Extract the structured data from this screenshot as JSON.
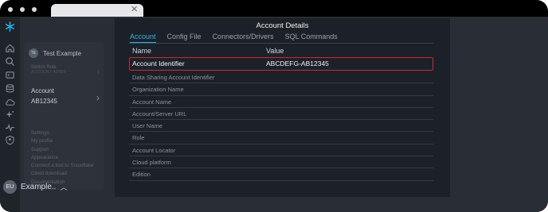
{
  "workspace": {
    "initials": "TE",
    "name": "Test Example"
  },
  "menu": {
    "switch_role_label": "Switch Role",
    "switch_role_value": "ACCOUNT ADMIN",
    "account_label": "Account",
    "account_value": "AB12345",
    "links": [
      "Settings",
      "My profile",
      "Support",
      "Appearance",
      "Connect a tool to Snowflake",
      "Client download",
      "Documentation"
    ]
  },
  "user": {
    "initials": "EU",
    "name": "Example.."
  },
  "modal": {
    "title": "Account Details",
    "tabs": [
      "Account",
      "Config File",
      "Connectors/Drivers",
      "SQL Commands"
    ],
    "active_tab": "Account",
    "columns": {
      "name": "Name",
      "value": "Value"
    },
    "rows": [
      {
        "name": "Account Identifier",
        "value": "ABCDEFG-AB12345"
      },
      {
        "name": "Data Sharing Account Identifier",
        "value": ""
      },
      {
        "name": "Organization Name",
        "value": ""
      },
      {
        "name": "Account Name",
        "value": ""
      },
      {
        "name": "Account/Server URL",
        "value": ""
      },
      {
        "name": "User Name",
        "value": ""
      },
      {
        "name": "Role",
        "value": ""
      },
      {
        "name": "Account Locator",
        "value": ""
      },
      {
        "name": "Cloud platform",
        "value": ""
      },
      {
        "name": "Edition",
        "value": ""
      }
    ],
    "highlight_color": "#d0262b",
    "accent_color": "#29b5e8"
  },
  "icons": {
    "rail": [
      "snowflake-icon",
      "home-icon",
      "search-icon",
      "projects-icon",
      "data-icon",
      "cloud-icon",
      "ai-icon",
      "monitoring-icon",
      "admin-icon"
    ]
  }
}
